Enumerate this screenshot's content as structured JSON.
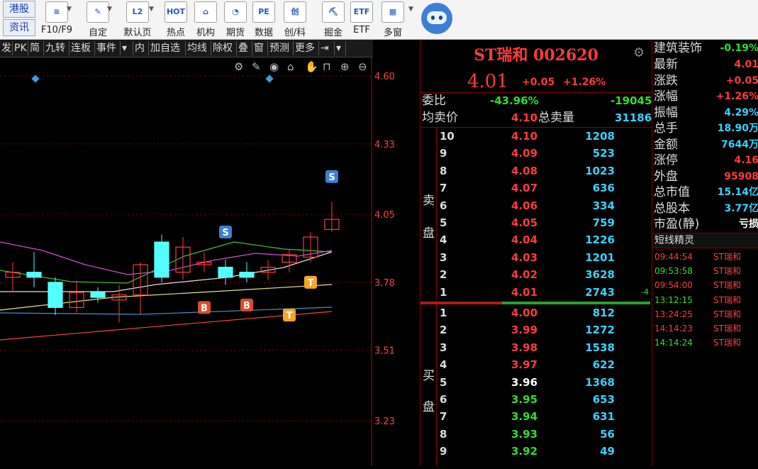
{
  "toolbar": {
    "news_buttons": [
      "港股",
      "资讯"
    ],
    "items": [
      {
        "label": "F10/F9",
        "icon": "f10-icon",
        "icon_text": "≡"
      },
      {
        "label": "自定",
        "icon": "custom-icon",
        "icon_text": "✎"
      },
      {
        "label": "默认页",
        "icon": "l2-icon",
        "icon_text": "L2"
      },
      {
        "label": "热点",
        "icon": "hot-icon",
        "icon_text": "HOT"
      },
      {
        "label": "机构",
        "icon": "institution-icon",
        "icon_text": "⌂"
      },
      {
        "label": "期货",
        "icon": "futures-icon",
        "icon_text": "◔"
      },
      {
        "label": "数据",
        "icon": "pe-icon",
        "icon_text": "PE"
      },
      {
        "label": "创/科",
        "icon": "chuang-icon",
        "icon_text": "创"
      },
      {
        "label": "掘金",
        "icon": "gold-icon",
        "icon_text": "⛏"
      },
      {
        "label": "ETF",
        "icon": "etf-icon",
        "icon_text": "ETF"
      },
      {
        "label": "多窗",
        "icon": "multiwindow-icon",
        "icon_text": "▦"
      }
    ]
  },
  "chart_menu": [
    "发",
    "PK",
    "简",
    "九转",
    "连板",
    "事件",
    "▾",
    "内",
    "加自选",
    "均线",
    "除权",
    "叠",
    "窗",
    "预测",
    "更多",
    "⇥",
    "▾"
  ],
  "chart_data": {
    "type": "candlestick",
    "y_ticks": [
      "4.60",
      "4.33",
      "4.05",
      "3.78",
      "3.51",
      "3.23"
    ],
    "ylim": [
      3.23,
      4.6
    ],
    "candles": [
      {
        "open": 3.8,
        "close": 3.82,
        "high": 3.86,
        "low": 3.74,
        "up": true
      },
      {
        "open": 3.8,
        "close": 3.82,
        "high": 3.9,
        "low": 3.76,
        "up": false
      },
      {
        "open": 3.78,
        "close": 3.68,
        "high": 3.8,
        "low": 3.65,
        "up": false
      },
      {
        "open": 3.68,
        "close": 3.74,
        "high": 3.78,
        "low": 3.66,
        "up": true
      },
      {
        "open": 3.72,
        "close": 3.74,
        "high": 3.76,
        "low": 3.7,
        "up": false
      },
      {
        "open": 3.71,
        "close": 3.73,
        "high": 3.77,
        "low": 3.62,
        "up": true
      },
      {
        "open": 3.85,
        "close": 3.73,
        "high": 3.86,
        "low": 3.65,
        "up": true
      },
      {
        "open": 3.94,
        "close": 3.8,
        "high": 3.97,
        "low": 3.78,
        "up": false
      },
      {
        "open": 3.92,
        "close": 3.82,
        "high": 3.96,
        "low": 3.79,
        "up": true
      },
      {
        "open": 3.85,
        "close": 3.86,
        "high": 3.9,
        "low": 3.82,
        "up": true
      },
      {
        "open": 3.84,
        "close": 3.8,
        "high": 3.87,
        "low": 3.77,
        "up": false
      },
      {
        "open": 3.8,
        "close": 3.82,
        "high": 3.86,
        "low": 3.78,
        "up": false
      },
      {
        "open": 3.82,
        "close": 3.84,
        "high": 3.87,
        "low": 3.79,
        "up": true
      },
      {
        "open": 3.86,
        "close": 3.89,
        "high": 3.91,
        "low": 3.82,
        "up": true
      },
      {
        "open": 3.88,
        "close": 3.96,
        "high": 3.98,
        "low": 3.86,
        "up": true
      },
      {
        "open": 3.99,
        "close": 4.03,
        "high": 4.1,
        "low": 3.98,
        "up": true
      }
    ],
    "signals": [
      {
        "label": "S",
        "candle": 10,
        "price": 3.98
      },
      {
        "label": "S",
        "candle": 15,
        "price": 4.2
      },
      {
        "label": "B",
        "candle": 9,
        "price": 3.68
      },
      {
        "label": "B",
        "candle": 11,
        "price": 3.69
      },
      {
        "label": "T",
        "candle": 13,
        "price": 3.65
      },
      {
        "label": "T",
        "candle": 14,
        "price": 3.78
      }
    ],
    "colors": {
      "up": "#ff3b3b",
      "down": "#54ffff",
      "axis": "#c00000",
      "grid": "#8b0000"
    }
  },
  "quote": {
    "name_code": "ST瑞和 002620",
    "price": "4.01",
    "change": "+0.05",
    "change_pct": "+1.26%",
    "weibi_label": "委比",
    "weibi_pct": "-43.96%",
    "weibi_diff": "-19045",
    "avg_sell_label": "均卖价",
    "avg_sell": "4.10",
    "total_sell_label": "总卖量",
    "total_sell": "31186",
    "sell_label": [
      "卖",
      "盘"
    ],
    "buy_label": [
      "买",
      "盘"
    ],
    "sell": [
      {
        "lvl": "10",
        "price": "4.10",
        "vol": "1208",
        "delta": ""
      },
      {
        "lvl": "9",
        "price": "4.09",
        "vol": "523",
        "delta": ""
      },
      {
        "lvl": "8",
        "price": "4.08",
        "vol": "1023",
        "delta": ""
      },
      {
        "lvl": "7",
        "price": "4.07",
        "vol": "636",
        "delta": ""
      },
      {
        "lvl": "6",
        "price": "4.06",
        "vol": "334",
        "delta": ""
      },
      {
        "lvl": "5",
        "price": "4.05",
        "vol": "759",
        "delta": ""
      },
      {
        "lvl": "4",
        "price": "4.04",
        "vol": "1226",
        "delta": ""
      },
      {
        "lvl": "3",
        "price": "4.03",
        "vol": "1201",
        "delta": ""
      },
      {
        "lvl": "2",
        "price": "4.02",
        "vol": "3628",
        "delta": ""
      },
      {
        "lvl": "1",
        "price": "4.01",
        "vol": "2743",
        "delta": "-4"
      }
    ],
    "buy": [
      {
        "lvl": "1",
        "price": "4.00",
        "vol": "812",
        "color": "red"
      },
      {
        "lvl": "2",
        "price": "3.99",
        "vol": "1272",
        "color": "red"
      },
      {
        "lvl": "3",
        "price": "3.98",
        "vol": "1538",
        "color": "red"
      },
      {
        "lvl": "4",
        "price": "3.97",
        "vol": "622",
        "color": "red"
      },
      {
        "lvl": "5",
        "price": "3.96",
        "vol": "1368",
        "color": "white"
      },
      {
        "lvl": "6",
        "price": "3.95",
        "vol": "653",
        "color": "green"
      },
      {
        "lvl": "7",
        "price": "3.94",
        "vol": "631",
        "color": "green"
      },
      {
        "lvl": "8",
        "price": "3.93",
        "vol": "56",
        "color": "green"
      },
      {
        "lvl": "9",
        "price": "3.92",
        "vol": "49",
        "color": "green"
      }
    ]
  },
  "side": {
    "sector": "建筑装饰",
    "sector_change": "-0.19%",
    "stats": [
      {
        "label": "最新",
        "value": "4.01",
        "color": "red"
      },
      {
        "label": "涨跌",
        "value": "+0.05",
        "color": "red"
      },
      {
        "label": "涨幅",
        "value": "+1.26%",
        "color": "red"
      },
      {
        "label": "振幅",
        "value": "4.29%",
        "color": "cyan"
      },
      {
        "label": "总手",
        "value": "18.90万",
        "color": "cyan"
      },
      {
        "label": "金额",
        "value": "7644万",
        "color": "cyan"
      },
      {
        "label": "涨停",
        "value": "4.16",
        "color": "red"
      },
      {
        "label": "外盘",
        "value": "95908",
        "color": "red"
      },
      {
        "label": "总市值",
        "value": "15.14亿",
        "color": "cyan"
      },
      {
        "label": "总股本",
        "value": "3.77亿",
        "color": "cyan"
      },
      {
        "label": "市盈(静)",
        "value": "亏损",
        "color": "white"
      }
    ],
    "sprite_title": "短线精灵",
    "feed": [
      {
        "time": "09:44:54",
        "name": "ST瑞和",
        "color": "red"
      },
      {
        "time": "09:53:58",
        "name": "ST瑞和",
        "color": "green"
      },
      {
        "time": "09:54:00",
        "name": "ST瑞和",
        "color": "red"
      },
      {
        "time": "13:12:15",
        "name": "ST瑞和",
        "color": "green"
      },
      {
        "time": "13:24:25",
        "name": "ST瑞和",
        "color": "red"
      },
      {
        "time": "14:14:23",
        "name": "ST瑞和",
        "color": "red"
      },
      {
        "time": "14:14:24",
        "name": "ST瑞和",
        "color": "green"
      }
    ]
  }
}
